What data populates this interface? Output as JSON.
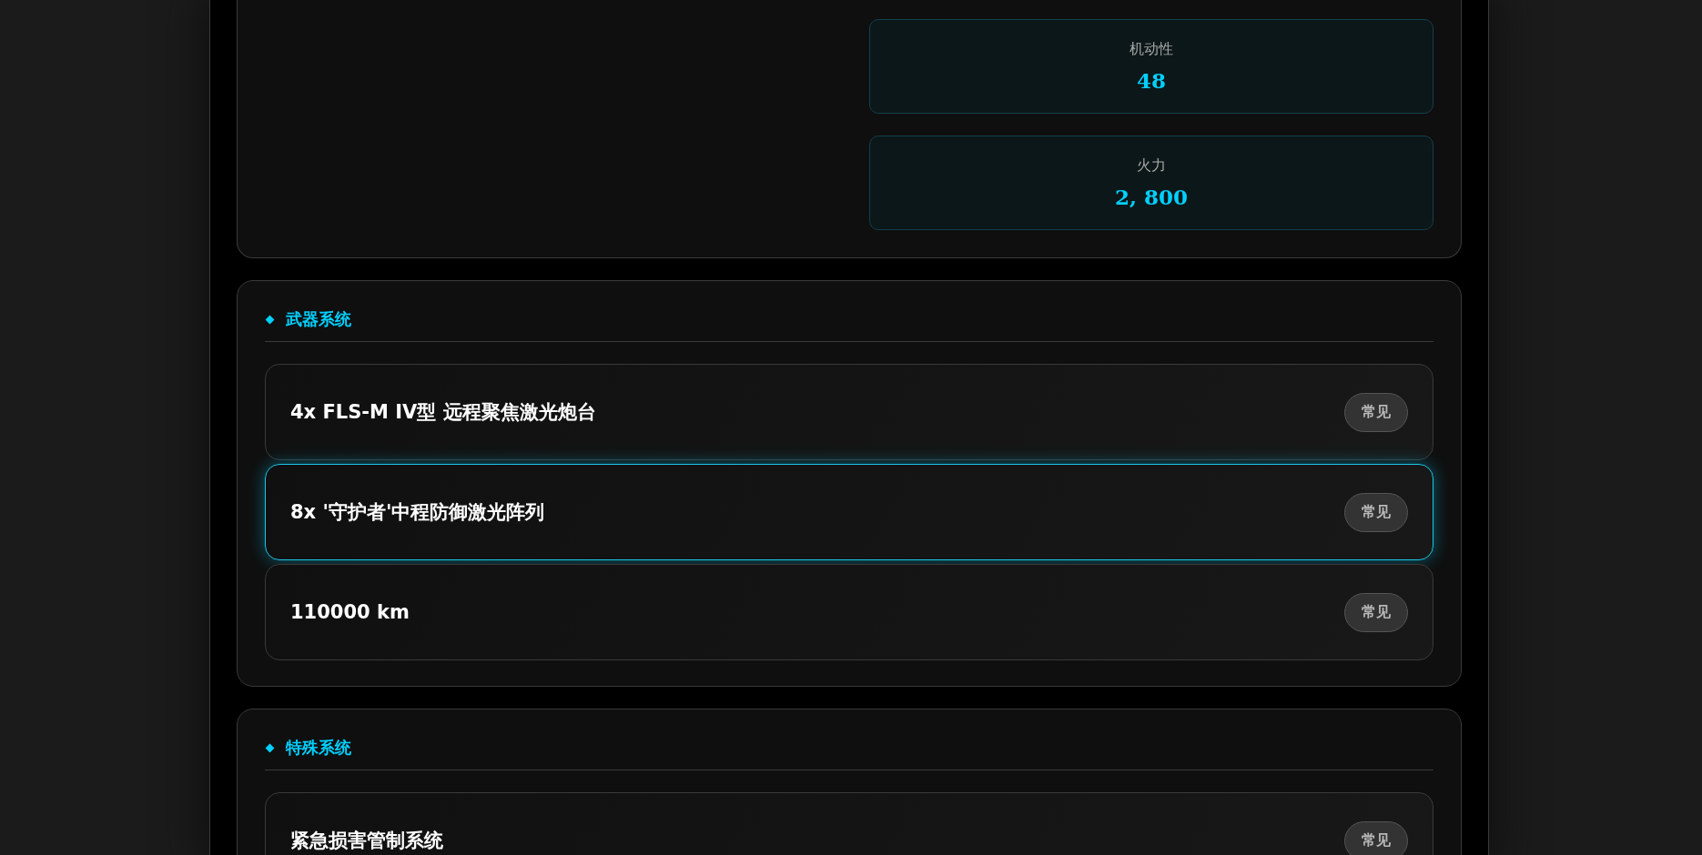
{
  "stats": [
    {
      "label": "机动性",
      "value": "48"
    },
    {
      "label": "火力",
      "value": "2, 800"
    }
  ],
  "sections": [
    {
      "title": "武器系统",
      "items": [
        {
          "name": "4x FLS-M IV型 远程聚焦激光炮台",
          "badge": "常见",
          "selected": false
        },
        {
          "name": "8x '守护者'中程防御激光阵列",
          "badge": "常见",
          "selected": true
        },
        {
          "name": "110000 km",
          "badge": "常见",
          "selected": false
        }
      ]
    },
    {
      "title": "特殊系统",
      "items": [
        {
          "name": "紧急损害管制系统",
          "badge": "常见",
          "selected": false
        }
      ]
    }
  ]
}
